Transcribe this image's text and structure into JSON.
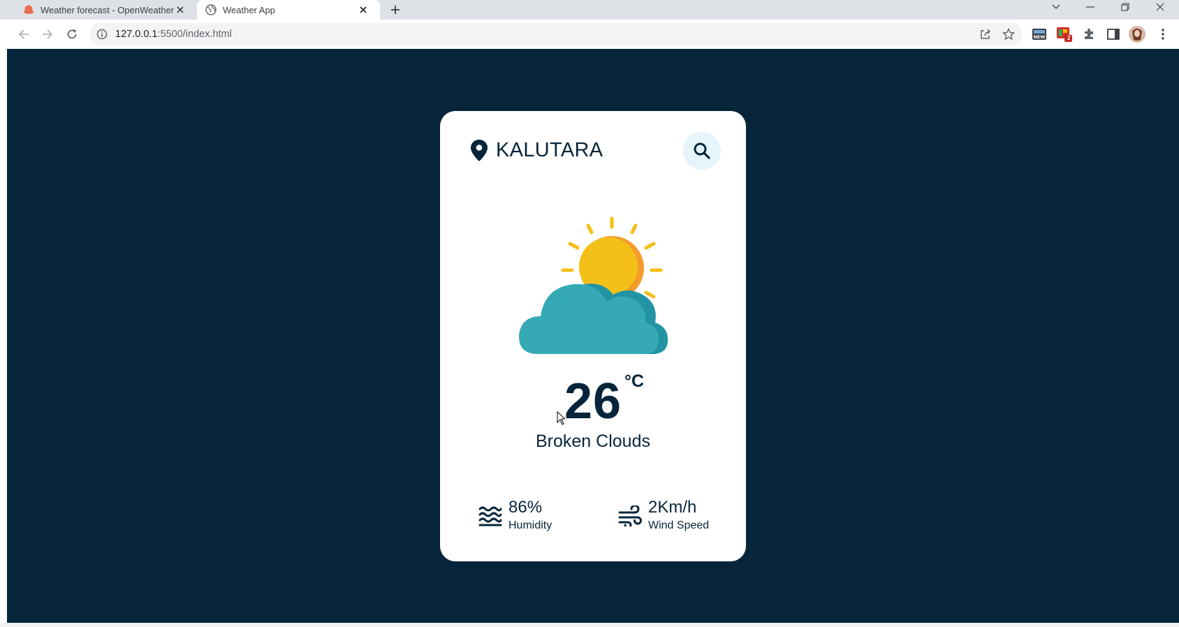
{
  "browser": {
    "tabs": [
      {
        "title": "Weather forecast - OpenWeather",
        "favicon": "openweather-icon"
      },
      {
        "title": "Weather App",
        "favicon": "globe-icon",
        "active": true
      }
    ],
    "url_host": "127.0.0.1",
    "url_path": ":5500/index.html",
    "extensions": [
      "new-extension-icon",
      "app-extension-icon",
      "puzzle-icon",
      "side-panel-icon",
      "profile-avatar",
      "kebab-menu-icon"
    ],
    "ext_badge": "2"
  },
  "app": {
    "city": "KALUTARA",
    "temperature": "26",
    "unit": "°C",
    "description": "Broken Clouds",
    "humidity": {
      "value": "86%",
      "label": "Humidity"
    },
    "wind": {
      "value": "2Km/h",
      "label": "Wind Speed"
    }
  },
  "colors": {
    "background": "#06253a",
    "card": "#ffffff",
    "text": "#06253a",
    "search_button_bg": "#e6f4fb",
    "sun": "#f4c018",
    "cloud": "#35aab6"
  }
}
